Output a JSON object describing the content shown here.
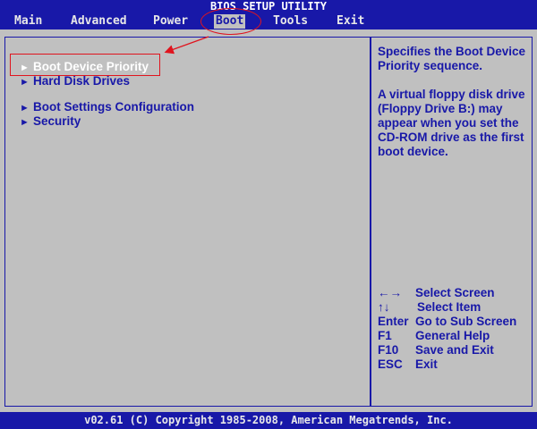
{
  "title": "BIOS SETUP UTILITY",
  "menu": [
    {
      "label": "Main",
      "selected": false
    },
    {
      "label": "Advanced",
      "selected": false
    },
    {
      "label": "Power",
      "selected": false
    },
    {
      "label": "Boot",
      "selected": true
    },
    {
      "label": "Tools",
      "selected": false
    },
    {
      "label": "Exit",
      "selected": false
    }
  ],
  "options": [
    {
      "label": "Boot Device Priority",
      "selected": true
    },
    {
      "label": "Hard Disk Drives",
      "selected": false
    },
    {
      "label": "Boot Settings Configuration",
      "selected": false
    },
    {
      "label": "Security",
      "selected": false
    }
  ],
  "arrow_glyph": "►",
  "help": {
    "description": "Specifies the Boot Device Priority sequence.",
    "note": "A virtual floppy disk drive (Floppy Drive B:) may appear when you set the CD-ROM drive as the first boot device."
  },
  "keys": [
    {
      "key": "←→",
      "desc": "Select Screen"
    },
    {
      "key": "↑↓",
      "desc": "Select Item"
    },
    {
      "key": "Enter",
      "desc": "Go to Sub Screen"
    },
    {
      "key": "F1",
      "desc": "General Help"
    },
    {
      "key": "F10",
      "desc": "Save and Exit"
    },
    {
      "key": "ESC",
      "desc": "Exit"
    }
  ],
  "footer": "v02.61 (C) Copyright 1985-2008, American Megatrends, Inc.",
  "colors": {
    "bios_blue": "#1818a8",
    "bios_gray": "#c0c0c0",
    "annotation_red": "#e0141e",
    "highlight_text": "#ffffff"
  }
}
